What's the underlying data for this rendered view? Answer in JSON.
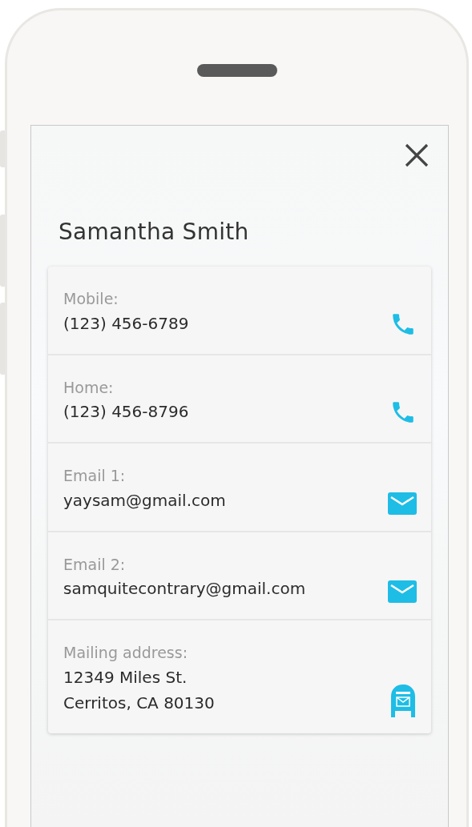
{
  "contact": {
    "name": "Samantha Smith"
  },
  "fields": [
    {
      "label": "Mobile:",
      "lines": [
        "(123) 456-6789"
      ],
      "kind": "phone"
    },
    {
      "label": "Home:",
      "lines": [
        "(123) 456-8796"
      ],
      "kind": "phone"
    },
    {
      "label": "Email 1:",
      "lines": [
        "yaysam@gmail.com"
      ],
      "kind": "email"
    },
    {
      "label": "Email 2:",
      "lines": [
        "samquitecontrary@gmail.com"
      ],
      "kind": "email"
    },
    {
      "label": "Mailing address:",
      "lines": [
        "12349 Miles St.",
        "Cerritos, CA 80130"
      ],
      "kind": "mailbox"
    }
  ]
}
